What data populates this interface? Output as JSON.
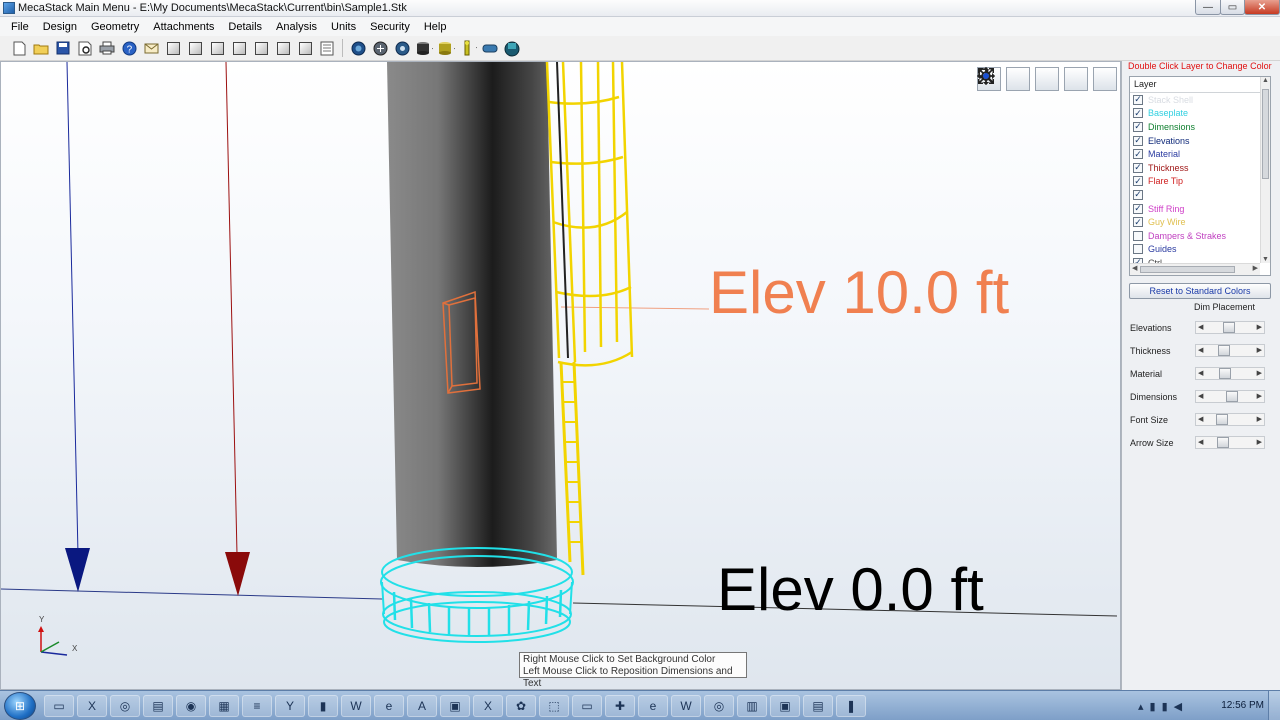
{
  "window": {
    "title": "MecaStack Main Menu - E:\\My Documents\\MecaStack\\Current\\bin\\Sample1.Stk",
    "min_glyph": "—",
    "max_glyph": "▭",
    "close_glyph": "✕"
  },
  "menu": [
    "File",
    "Design",
    "Geometry",
    "Attachments",
    "Details",
    "Analysis",
    "Units",
    "Security",
    "Help"
  ],
  "toolbar": {
    "icons": [
      "new-file-icon",
      "open-folder-icon",
      "save-icon",
      "print-preview-icon",
      "print-icon",
      "help-icon",
      "mail-icon",
      "stack-view-1-icon",
      "stack-view-2-icon",
      "stack-view-3-icon",
      "stack-view-4-icon",
      "stack-view-5-icon",
      "stack-view-6-icon",
      "stack-view-7-icon",
      "stack-view-8-icon",
      "globe-icon",
      "wind-icon",
      "seismic-icon",
      "cylinder-icon",
      "drum-icon",
      "ladder-icon",
      "pipe-icon",
      "render-icon"
    ]
  },
  "viewport": {
    "elev_top": "Elev 10.0 ft",
    "elev_bottom": "Elev 0.0 ft",
    "tooltip_line1": "Right Mouse Click to Set Background Color",
    "tooltip_line2": "Left Mouse Click to Reposition Dimensions and Text",
    "axis_y": "Y",
    "axis_x": "X",
    "view_buttons": [
      "zoom-window-icon",
      "zoom-icon",
      "pan-icon",
      "rotate-icon",
      "fit-extents-icon"
    ],
    "colors": {
      "elevation": "#f08050",
      "baseplate": "#21e0e8",
      "ladder": "#f2d400",
      "arrow_blue": "#1a2a9c",
      "arrow_red": "#9c1010",
      "detail": "#e0703c"
    }
  },
  "panel": {
    "hint": "Double Click Layer to Change Color",
    "layer_header": "Layer",
    "layers": [
      {
        "label": "Stack Shell",
        "color": "#d8dce2",
        "checked": true
      },
      {
        "label": "Baseplate",
        "color": "#30d0e0",
        "checked": true
      },
      {
        "label": "Dimensions",
        "color": "#108030",
        "checked": true
      },
      {
        "label": "Elevations",
        "color": "#102a7a",
        "checked": true
      },
      {
        "label": "Material",
        "color": "#2a3aa0",
        "checked": true
      },
      {
        "label": "Thickness",
        "color": "#a01818",
        "checked": true
      },
      {
        "label": "Flare Tip",
        "color": "#d02020",
        "checked": true
      },
      {
        "label": "",
        "color": "#000000",
        "checked": true
      },
      {
        "label": "Stiff Ring",
        "color": "#d040c8",
        "checked": true
      },
      {
        "label": "Guy Wire",
        "color": "#e0c050",
        "checked": true
      },
      {
        "label": "Dampers & Strakes",
        "color": "#c040c0",
        "checked": false
      },
      {
        "label": "Guides",
        "color": "#2a3aa0",
        "checked": false
      },
      {
        "label": "Ctrl",
        "color": "#444444",
        "checked": true
      }
    ],
    "reset_label": "Reset to Standard Colors",
    "dim_title": "Dim Placement",
    "dims": [
      {
        "label": "Elevations",
        "level": 0.45
      },
      {
        "label": "Thickness",
        "level": 0.33
      },
      {
        "label": "Material",
        "level": 0.35
      },
      {
        "label": "Dimensions",
        "level": 0.52
      },
      {
        "label": "Font Size",
        "level": 0.28
      },
      {
        "label": "Arrow Size",
        "level": 0.3
      }
    ]
  },
  "taskbar": {
    "start_glyph": "⊞",
    "items": [
      "▭",
      "X",
      "◎",
      "▤",
      "◉",
      "▦",
      "≡",
      "Y",
      "▮",
      "W",
      "e",
      "A",
      "▣",
      "X",
      "✿",
      "⬚",
      "▭",
      "✚",
      "e",
      "W",
      "◎",
      "▥",
      "▣",
      "▤",
      "❚"
    ],
    "tray": [
      "▴",
      "▮",
      "▮",
      "◀"
    ],
    "clock": "12:56 PM"
  }
}
